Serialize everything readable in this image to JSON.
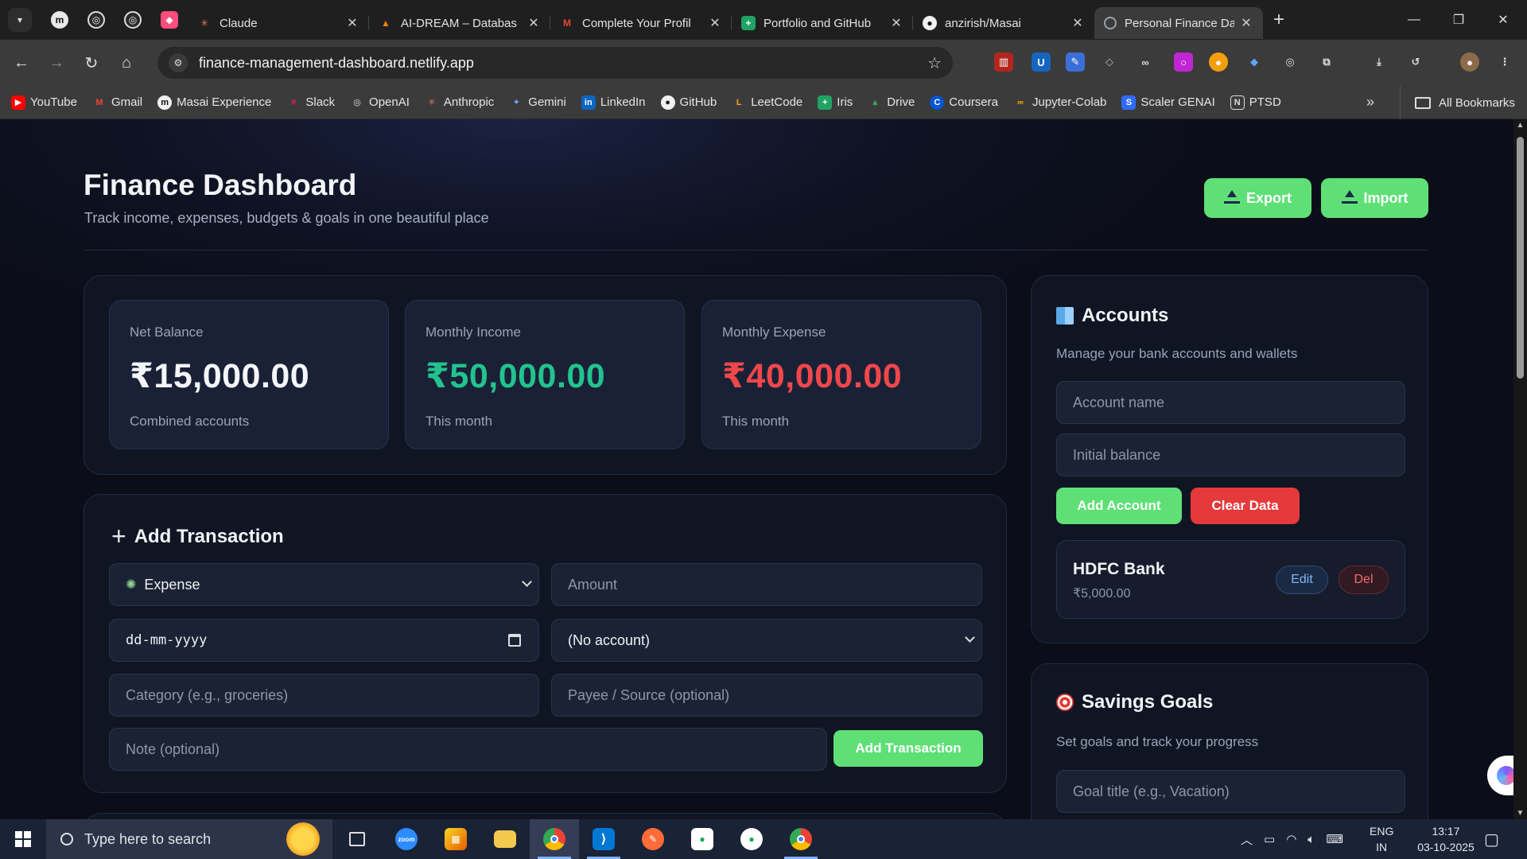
{
  "browser": {
    "tabs": [
      {
        "title": "Claude",
        "favicon_color": "#d97757",
        "glyph": "✳"
      },
      {
        "title": "AI-DREAM – Databas",
        "favicon_color": "#f57c00",
        "glyph": "▲"
      },
      {
        "title": "Complete Your Profil",
        "favicon_color": "#ea4335",
        "glyph": "M"
      },
      {
        "title": "Portfolio and GitHub",
        "favicon_color": "#1fa463",
        "glyph": "+"
      },
      {
        "title": "anzirish/Masai",
        "favicon_color": "#f0f0f0",
        "glyph": "●"
      },
      {
        "title": "Personal Finance Das",
        "favicon_color": "#9aa0a6",
        "glyph": "◍"
      }
    ],
    "url": "finance-management-dashboard.netlify.app",
    "bookmarks": [
      {
        "label": "YouTube",
        "color": "#ff0000",
        "glyph": "▶"
      },
      {
        "label": "Gmail",
        "color": "#ea4335",
        "glyph": "M"
      },
      {
        "label": "Masai Experience",
        "color": "#f0f0f0",
        "glyph": "m"
      },
      {
        "label": "Slack",
        "color": "#611f69",
        "glyph": "#"
      },
      {
        "label": "OpenAI",
        "color": "#444444",
        "glyph": "◎"
      },
      {
        "label": "Anthropic",
        "color": "#d97757",
        "glyph": "✳"
      },
      {
        "label": "Gemini",
        "color": "#4b7bec",
        "glyph": "✦"
      },
      {
        "label": "LinkedIn",
        "color": "#0a66c2",
        "glyph": "in"
      },
      {
        "label": "GitHub",
        "color": "#333333",
        "glyph": "●"
      },
      {
        "label": "LeetCode",
        "color": "#f89f1b",
        "glyph": "L"
      },
      {
        "label": "Iris",
        "color": "#1fa463",
        "glyph": "+"
      },
      {
        "label": "Drive",
        "color": "#34a853",
        "glyph": "▲"
      },
      {
        "label": "Coursera",
        "color": "#0056d2",
        "glyph": "C"
      },
      {
        "label": "Jupyter-Colab",
        "color": "#f9ab00",
        "glyph": "∞"
      },
      {
        "label": "Scaler GENAI",
        "color": "#2f6bff",
        "glyph": "S"
      },
      {
        "label": "PTSD",
        "color": "#555555",
        "glyph": "N"
      }
    ],
    "more_bookmarks": "»",
    "all_bookmarks": "All Bookmarks"
  },
  "header": {
    "title": "Finance Dashboard",
    "subtitle": "Track income, expenses, budgets & goals in one beautiful place",
    "export_label": "Export",
    "import_label": "Import"
  },
  "stats": [
    {
      "label": "Net Balance",
      "value": "₹15,000.00",
      "foot": "Combined accounts",
      "color": "#f4f5f8"
    },
    {
      "label": "Monthly Income",
      "value": "₹50,000.00",
      "foot": "This month",
      "color": "#22c38e"
    },
    {
      "label": "Monthly Expense",
      "value": "₹40,000.00",
      "foot": "This month",
      "color": "#f0474b"
    }
  ],
  "add_transaction": {
    "title": "Add Transaction",
    "type_value": "Expense",
    "amount_placeholder": "Amount",
    "date_placeholder": "dd-mm-yyyy",
    "account_value": "(No account)",
    "category_placeholder": "Category (e.g., groceries)",
    "payee_placeholder": "Payee / Source (optional)",
    "note_placeholder": "Note (optional)",
    "submit_label": "Add Transaction"
  },
  "accounts": {
    "title": "Accounts",
    "description": "Manage your bank accounts and wallets",
    "name_placeholder": "Account name",
    "balance_placeholder": "Initial balance",
    "add_label": "Add Account",
    "clear_label": "Clear Data",
    "items": [
      {
        "name": "HDFC Bank",
        "balance": "₹5,000.00",
        "edit_label": "Edit",
        "delete_label": "Del"
      }
    ]
  },
  "goals": {
    "title": "Savings Goals",
    "description": "Set goals and track your progress",
    "title_placeholder": "Goal title (e.g., Vacation)"
  },
  "taskbar": {
    "search_placeholder": "Type here to search",
    "lang_top": "ENG",
    "lang_bottom": "IN",
    "time": "13:17",
    "date": "03-10-2025"
  }
}
